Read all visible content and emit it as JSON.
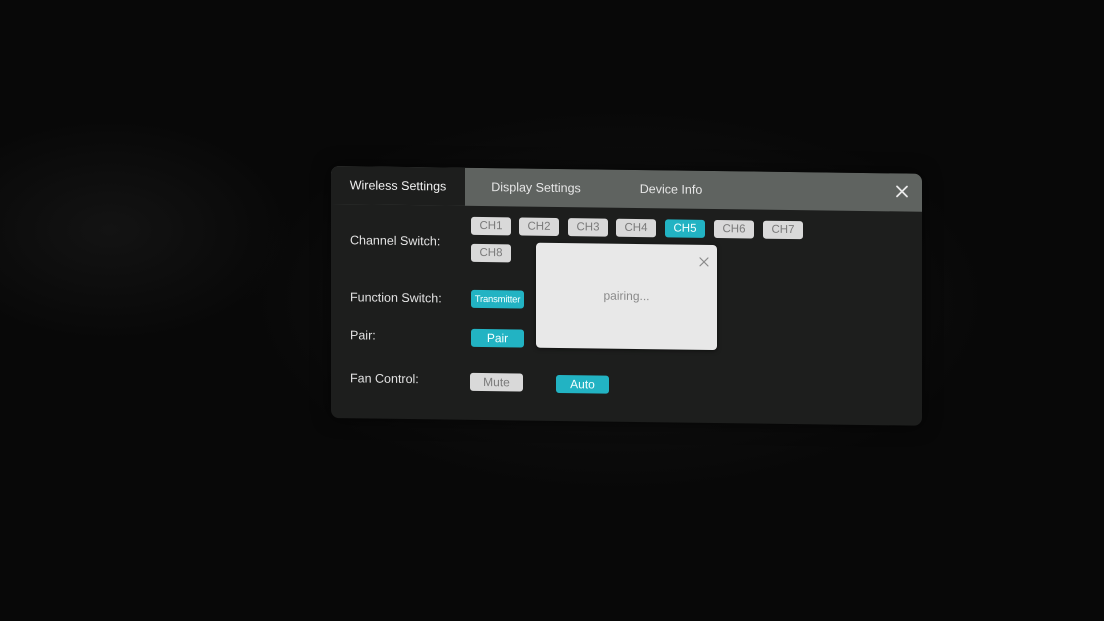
{
  "tabs": [
    {
      "label": "Wireless Settings",
      "active": true
    },
    {
      "label": "Display Settings",
      "active": false
    },
    {
      "label": "Device Info",
      "active": false
    }
  ],
  "icons": {
    "close": "close-icon",
    "modal_close": "close-icon"
  },
  "colors": {
    "accent": "#22b3c3",
    "panel_bg": "#1d1e1d",
    "tabbar_bg": "#5f6360",
    "chip_bg": "#d9d9d9",
    "modal_bg": "#e8e8e8"
  },
  "wireless": {
    "channel_switch": {
      "label": "Channel Switch:",
      "channels": [
        "CH1",
        "CH2",
        "CH3",
        "CH4",
        "CH5",
        "CH6",
        "CH7",
        "CH8"
      ],
      "selected": "CH5"
    },
    "function_switch": {
      "label": "Function Switch:",
      "value": "Transmitter"
    },
    "pair": {
      "label": "Pair:",
      "button": "Pair"
    },
    "fan_control": {
      "label": "Fan Control:",
      "options": [
        "Mute",
        "Auto"
      ],
      "selected": "Auto"
    }
  },
  "modal": {
    "message": "pairing..."
  }
}
